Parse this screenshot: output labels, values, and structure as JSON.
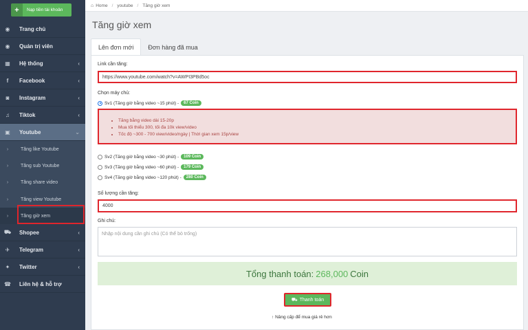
{
  "sidebar": {
    "topup_label": "Nạp tiền tài khoản",
    "items": [
      {
        "label": "Trang chủ",
        "icon": "dashboard-icon",
        "glyph": "◉"
      },
      {
        "label": "Quản trị viên",
        "icon": "dashboard-icon",
        "glyph": "◉"
      },
      {
        "label": "Hệ thống",
        "icon": "grid-icon",
        "glyph": "▦"
      },
      {
        "label": "Facebook",
        "icon": "facebook-icon",
        "glyph": "f"
      },
      {
        "label": "Instagram",
        "icon": "camera-icon",
        "glyph": "◙"
      },
      {
        "label": "Tiktok",
        "icon": "music-icon",
        "glyph": "♫"
      },
      {
        "label": "Youtube",
        "icon": "youtube-icon",
        "glyph": "▣"
      }
    ],
    "youtube_sub": [
      {
        "label": "Tăng like Youtube"
      },
      {
        "label": "Tăng sub Youtube"
      },
      {
        "label": "Tăng share video"
      },
      {
        "label": "Tăng view Youtube"
      },
      {
        "label": "Tăng giờ xem"
      }
    ],
    "bottom_items": [
      {
        "label": "Shopee",
        "icon": "cart-icon",
        "glyph": "⛟"
      },
      {
        "label": "Telegram",
        "icon": "telegram-icon",
        "glyph": "✈"
      },
      {
        "label": "Twitter",
        "icon": "twitter-icon",
        "glyph": "✦"
      },
      {
        "label": "Liên hệ & hỗ trợ",
        "icon": "support-icon",
        "glyph": "☎"
      }
    ]
  },
  "breadcrumb": {
    "home": "Home",
    "c1": "youtube",
    "c2": "Tăng giờ xem"
  },
  "page_title": "Tăng giờ xem",
  "tabs": {
    "new_order": "Lên đơn mới",
    "purchased": "Đơn hàng đã mua"
  },
  "form": {
    "link_label": "Link cần tăng:",
    "link_value": "https://www.youtube.com/watch?v=AWPI3PBd5oc",
    "server_label": "Chọn máy chủ:",
    "servers": [
      {
        "label": "Sv1 (Tăng giờ bằng video ~15 phút) -",
        "price": "67 Coin",
        "checked": true
      },
      {
        "label": "Sv2 (Tăng giờ bằng video ~30 phút) -",
        "price": "109 Coin",
        "checked": false
      },
      {
        "label": "Sv3 (Tăng giờ bằng video ~60 phút) -",
        "price": "179 Coin",
        "checked": false
      },
      {
        "label": "Sv4 (Tăng giờ bằng video ~120 phút) -",
        "price": "280 Coin",
        "checked": false
      }
    ],
    "info_lines": [
      "Tăng bằng video dài 15-20p",
      "Mua tối thiểu 300, tối đa 10k view/video",
      "Tốc độ ~300 - 700 view/video/ngày | Thời gian xem 15p/view"
    ],
    "qty_label": "Số lượng cần tăng:",
    "qty_value": "4000",
    "note_label": "Ghi chú:",
    "note_placeholder": "Nhập nội dung cần ghi chú (Có thể bỏ trống)"
  },
  "total": {
    "prefix": "Tổng thanh toán:",
    "amount": "268,000",
    "unit": "Coin"
  },
  "pay_button": "Thanh toán",
  "upgrade_text": "Nâng cấp để mua giá rẻ hơn",
  "colors": {
    "sidebar_bg": "#2f3c4f",
    "accent_green": "#5cb85c",
    "highlight_red": "#e0252c"
  }
}
